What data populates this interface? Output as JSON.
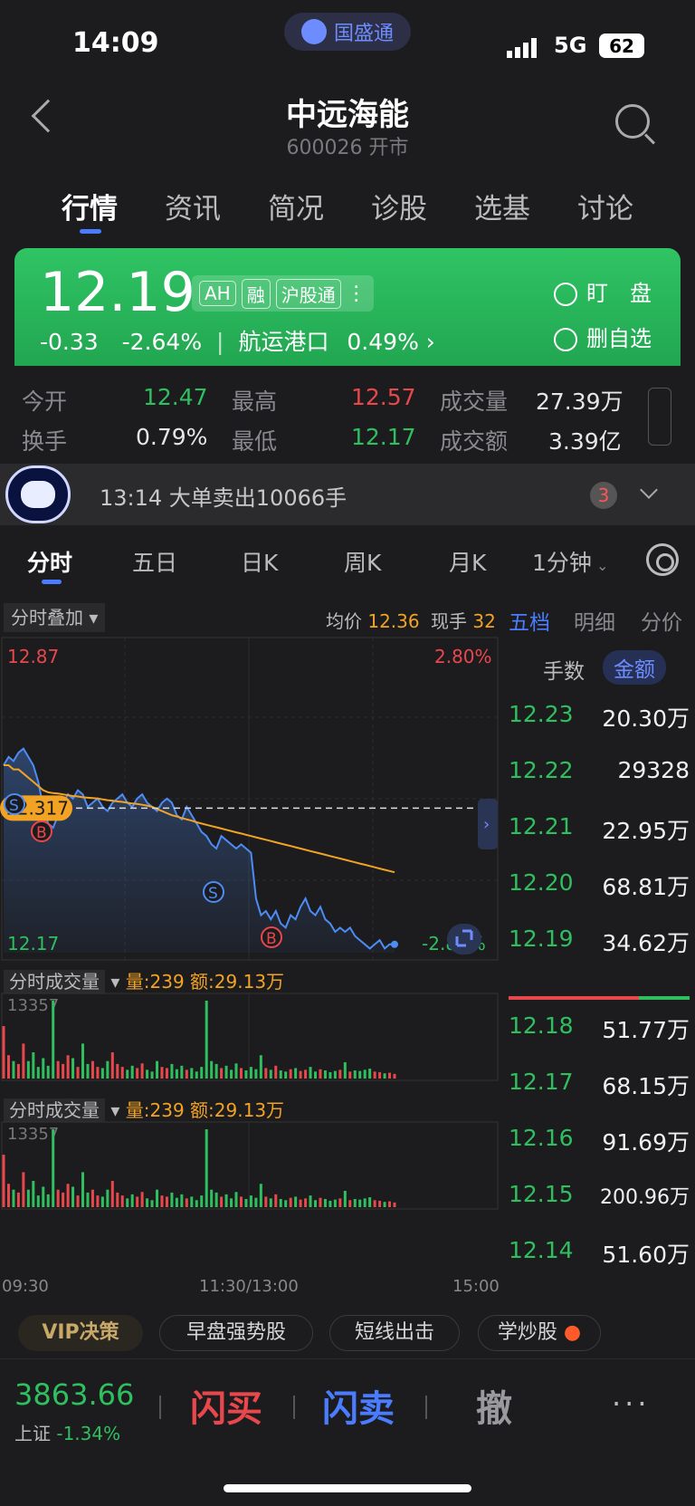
{
  "status_bar": {
    "time": "14:09",
    "app_pill": "国盛通",
    "network": "5G",
    "battery": "62"
  },
  "header": {
    "title": "中远海能",
    "subtitle": "600026 开市"
  },
  "top_tabs": [
    "行情",
    "资讯",
    "简况",
    "诊股",
    "选基",
    "讨论"
  ],
  "quote": {
    "price": "12.19",
    "change": "-0.33",
    "change_pct": "-2.64%",
    "sector": "航运港口",
    "sector_pct": "0.49%",
    "badges": [
      "AH",
      "融",
      "沪股通"
    ],
    "watch_label": "盯　盘",
    "remove_label": "删自选"
  },
  "stats": {
    "open_label": "今开",
    "open": "12.47",
    "high_label": "最高",
    "high": "12.57",
    "volume_label": "成交量",
    "volume": "27.39万",
    "turnover_label": "换手",
    "turnover": "0.79%",
    "low_label": "最低",
    "low": "12.17",
    "amount_label": "成交额",
    "amount": "3.39亿"
  },
  "news": {
    "text": "13:14 大单卖出10066手",
    "count": "3"
  },
  "chart_tabs": [
    "分时",
    "五日",
    "日K",
    "周K",
    "月K",
    "1分钟"
  ],
  "chart_header": {
    "overlay": "分时叠加",
    "avg_label": "均价",
    "avg_value": "12.36",
    "cur_label": "现手",
    "cur_value": "32"
  },
  "chart_data": {
    "type": "line",
    "title": "",
    "ylim": [
      12.17,
      12.87
    ],
    "y_top_label": "12.87",
    "y_bottom_label": "12.17",
    "pct_top_label": "2.80%",
    "pct_bottom_label": "-2.80%",
    "prev_close_label": "12.317",
    "prev_close": 12.517,
    "x_labels": [
      "09:30",
      "11:30/13:00",
      "15:00"
    ],
    "series": [
      {
        "values": [
          12.62,
          12.64,
          12.63,
          12.65,
          12.66,
          12.64,
          12.62,
          12.58,
          12.52,
          12.48,
          12.47,
          12.5,
          12.53,
          12.55,
          12.54,
          12.56,
          12.55,
          12.52,
          12.53,
          12.54,
          12.52,
          12.51,
          12.53,
          12.54,
          12.55,
          12.53,
          12.52,
          12.54,
          12.55,
          12.53,
          12.52,
          12.51,
          12.53,
          12.54,
          12.53,
          12.5,
          12.49,
          12.52,
          12.5,
          12.48,
          12.46,
          12.45,
          12.43,
          12.42,
          12.45,
          12.44,
          12.43,
          12.42,
          12.43,
          12.42,
          12.41,
          12.3,
          12.26,
          12.27,
          12.25,
          12.27,
          12.24,
          12.23,
          12.26,
          12.25,
          12.28,
          12.3,
          12.27,
          12.26,
          12.28,
          12.25,
          12.24,
          12.22,
          12.23,
          12.22,
          12.23,
          12.21,
          12.2,
          12.19,
          12.18,
          12.19,
          12.2,
          12.18,
          12.19,
          12.19
        ]
      },
      {
        "values": [
          12.62,
          12.62,
          12.61,
          12.61,
          12.6,
          12.59,
          12.58,
          12.57,
          12.56,
          12.555,
          12.553,
          12.552,
          12.55,
          12.548,
          12.546,
          12.545,
          12.543,
          12.542,
          12.541,
          12.54,
          12.538,
          12.536,
          12.535,
          12.533,
          12.532,
          12.53,
          12.528,
          12.527,
          12.525,
          12.523,
          12.52,
          12.515,
          12.51,
          12.505,
          12.5,
          12.497,
          12.493,
          12.49,
          12.487,
          12.483,
          12.48,
          12.477,
          12.474,
          12.471,
          12.468,
          12.465,
          12.462,
          12.459,
          12.456,
          12.453,
          12.45,
          12.447,
          12.444,
          12.441,
          12.438,
          12.435,
          12.432,
          12.429,
          12.426,
          12.423,
          12.42,
          12.417,
          12.414,
          12.411,
          12.408,
          12.405,
          12.402,
          12.399,
          12.396,
          12.393,
          12.39,
          12.387,
          12.384,
          12.381,
          12.378,
          12.375,
          12.372,
          12.369,
          12.366,
          12.363
        ]
      }
    ],
    "volume": {
      "label": "分时成交量",
      "amount_label": "量:239",
      "value_label": "额:29.13万",
      "max_label": "13357",
      "values": [
        9000,
        4000,
        3000,
        2500,
        6000,
        3000,
        4500,
        2000,
        3500,
        2200,
        13357,
        3000,
        2500,
        4000,
        3500,
        2000,
        6000,
        2500,
        3000,
        2000,
        1800,
        3000,
        4500,
        2500,
        2000,
        1500,
        2200,
        1800,
        2600,
        1500,
        1200,
        3000,
        2000,
        1800,
        2500,
        1600,
        2200,
        1500,
        1800,
        1200,
        2000,
        13357,
        3000,
        2500,
        1800,
        2200,
        1500,
        2600,
        1800,
        1400,
        2000,
        1600,
        4000,
        1800,
        1500,
        2200,
        1400,
        1200,
        1600,
        1800,
        1300,
        1500,
        2000,
        1200,
        1600,
        1400,
        1100,
        1300,
        1500,
        2800,
        1200,
        1400,
        1300,
        1500,
        1700,
        1200,
        1100,
        900,
        1000,
        800
      ]
    }
  },
  "order_book": {
    "tabs": [
      "五档",
      "明细",
      "分价"
    ],
    "toggle": [
      "手数",
      "金额"
    ],
    "asks": [
      {
        "price": "12.23",
        "amount": "20.30万"
      },
      {
        "price": "12.22",
        "amount": "29328"
      },
      {
        "price": "12.21",
        "amount": "22.95万"
      },
      {
        "price": "12.20",
        "amount": "68.81万"
      },
      {
        "price": "12.19",
        "amount": "34.62万"
      }
    ],
    "bids": [
      {
        "price": "12.18",
        "amount": "51.77万"
      },
      {
        "price": "12.17",
        "amount": "68.15万"
      },
      {
        "price": "12.16",
        "amount": "91.69万"
      },
      {
        "price": "12.15",
        "amount": "200.96万"
      },
      {
        "price": "12.14",
        "amount": "51.60万"
      }
    ]
  },
  "chips": [
    "VIP决策",
    "早盘强势股",
    "短线出击",
    "学炒股"
  ],
  "bottom_bar": {
    "index_value": "3863.66",
    "index_name": "上证",
    "index_pct": "-1.34%",
    "buy_label": "闪买",
    "sell_label": "闪卖",
    "cancel_label": "撤",
    "more_label": "···"
  },
  "colors": {
    "up": "#e8474c",
    "down": "#2fbf5f",
    "accent": "#4a7cff",
    "avg_line": "#f2a324",
    "price_line": "#4d8cf5"
  }
}
